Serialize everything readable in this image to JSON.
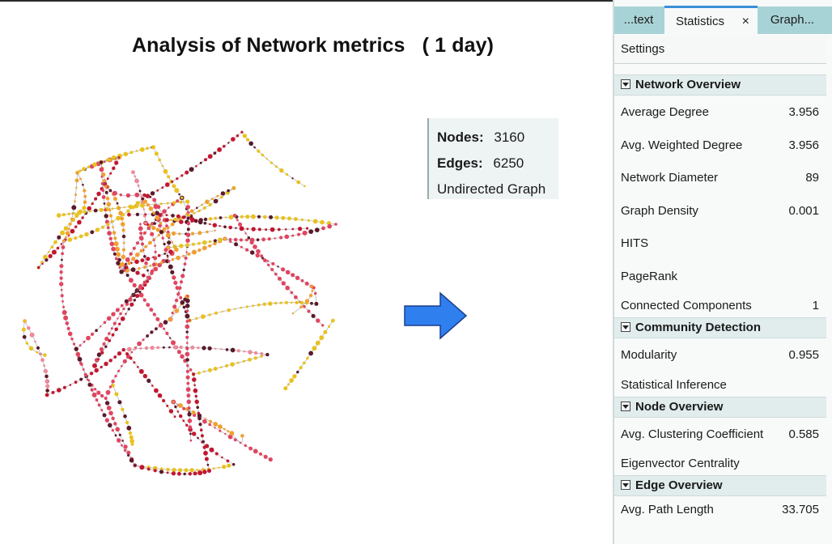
{
  "title": "Analysis of Network metrics   ( 1 day)",
  "graph_summary": {
    "nodes_label": "Nodes:",
    "nodes_value": "3160",
    "edges_label": "Edges:",
    "edges_value": "6250",
    "graph_type": "Undirected Graph"
  },
  "graph_colors": [
    "#c2172f",
    "#e0455f",
    "#ee8a9a",
    "#f0a030",
    "#e8c21e",
    "#8a8a9a"
  ],
  "arrow_color": "#2f7fef",
  "panel": {
    "tabs": [
      {
        "label": "...text"
      },
      {
        "label": "Statistics",
        "close": "×",
        "active": true
      },
      {
        "label": "Graph..."
      }
    ],
    "settings_label": "Settings",
    "sections": [
      {
        "title": "Network Overview",
        "rows": [
          {
            "name": "Average Degree",
            "value": "3.956"
          },
          {
            "name": "Avg. Weighted Degree",
            "value": "3.956"
          },
          {
            "name": "Network Diameter",
            "value": "89"
          },
          {
            "name": "Graph Density",
            "value": "0.001"
          },
          {
            "name": "HITS",
            "value": ""
          },
          {
            "name": "PageRank",
            "value": ""
          },
          {
            "name": "Connected Components",
            "value": "1"
          }
        ]
      },
      {
        "title": "Community Detection",
        "rows": [
          {
            "name": "Modularity",
            "value": "0.955"
          },
          {
            "name": "Statistical Inference",
            "value": ""
          }
        ]
      },
      {
        "title": "Node Overview",
        "rows": [
          {
            "name": "Avg. Clustering Coefficient",
            "value": "0.585"
          },
          {
            "name": "Eigenvector Centrality",
            "value": ""
          }
        ]
      },
      {
        "title": "Edge Overview",
        "rows": [
          {
            "name": "Avg. Path Length",
            "value": "33.705"
          }
        ]
      }
    ]
  }
}
